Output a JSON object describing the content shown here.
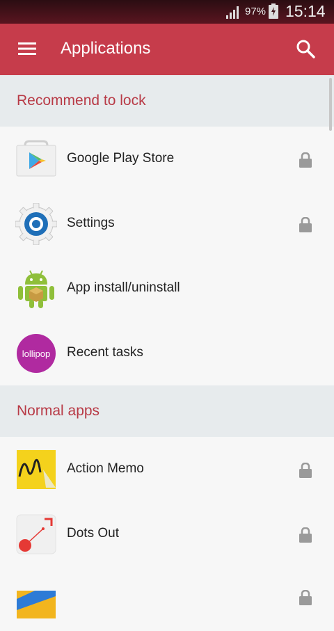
{
  "status_bar": {
    "battery_percent": "97%",
    "time": "15:14",
    "icons": [
      "signal-icon",
      "battery-charging-icon"
    ]
  },
  "app_bar": {
    "title": "Applications",
    "icons": [
      "menu-icon",
      "search-icon"
    ],
    "color": "#c63c4b"
  },
  "sections": [
    {
      "title": "Recommend to lock",
      "items": [
        {
          "label": "Google Play Store",
          "locked": true,
          "icon": "google-play-store-icon"
        },
        {
          "label": "Settings",
          "locked": true,
          "icon": "settings-gear-icon"
        },
        {
          "label": "App install/uninstall",
          "locked": false,
          "icon": "android-robot-icon"
        },
        {
          "label": "Recent tasks",
          "locked": false,
          "icon": "lollipop-icon",
          "icon_text": "lollipop"
        }
      ]
    },
    {
      "title": "Normal apps",
      "items": [
        {
          "label": "Action Memo",
          "locked": true,
          "icon": "action-memo-icon"
        },
        {
          "label": "Dots Out",
          "locked": true,
          "icon": "dots-out-icon"
        },
        {
          "label": "",
          "locked": true,
          "icon": "gallery-icon"
        }
      ]
    }
  ],
  "colors": {
    "accent": "#c63c4b",
    "section_title": "#b83a46",
    "section_bg": "#e7ebed",
    "lock_icon": "#9a9a9a"
  }
}
